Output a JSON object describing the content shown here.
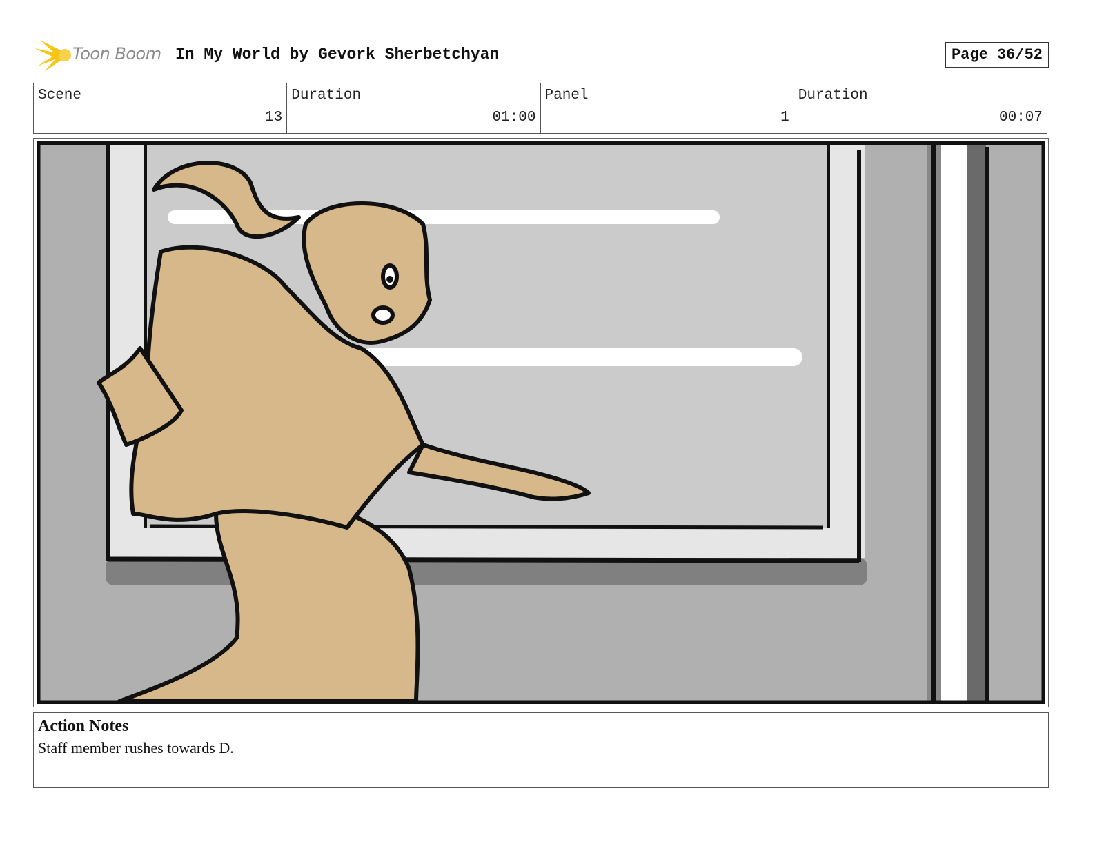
{
  "header": {
    "logo_text": "Toon Boom",
    "title": "In My World by Gevork Sherbetchyan",
    "page": "Page 36/52"
  },
  "meta": {
    "scene_label": "Scene",
    "scene_value": "13",
    "scene_duration_label": "Duration",
    "scene_duration_value": "01:00",
    "panel_label": "Panel",
    "panel_value": "1",
    "panel_duration_label": "Duration",
    "panel_duration_value": "00:07"
  },
  "notes": {
    "title": "Action Notes",
    "text": "Staff member rushes towards D."
  },
  "colors": {
    "skin": "#d6b88a",
    "wall": "#b0b0b0",
    "window": "#cbcbcb",
    "logo_accent": "#f5c518"
  }
}
